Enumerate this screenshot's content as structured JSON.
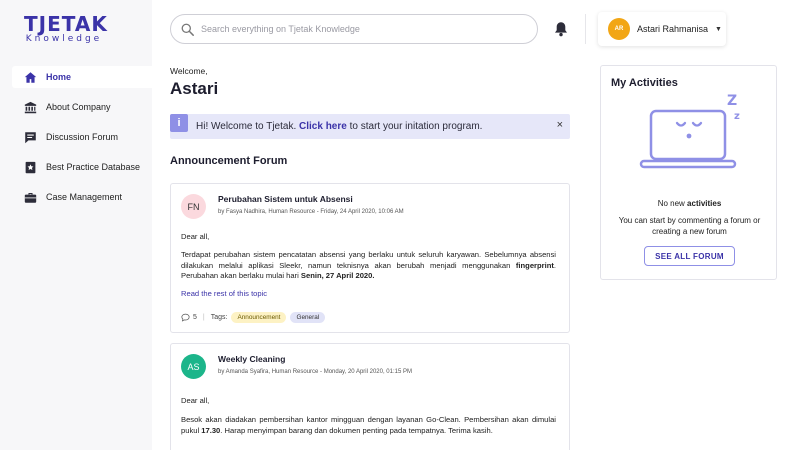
{
  "brand": {
    "logo_main": "TJETAK",
    "logo_sub": "Knowledge",
    "accent": "#3b33a8"
  },
  "sidebar": {
    "items": [
      {
        "label": "Home",
        "icon": "home-icon",
        "active": true
      },
      {
        "label": "About Company",
        "icon": "building-icon",
        "active": false
      },
      {
        "label": "Discussion Forum",
        "icon": "chat-icon",
        "active": false
      },
      {
        "label": "Best Practice Database",
        "icon": "star-book-icon",
        "active": false
      },
      {
        "label": "Case Management",
        "icon": "briefcase-icon",
        "active": false
      }
    ]
  },
  "header": {
    "search_placeholder": "Search everything on Tjetak Knowledge",
    "user": {
      "initials": "AR",
      "name": "Astari Rahmanisa",
      "avatar_color": "#f2a615"
    }
  },
  "main": {
    "welcome": "Welcome,",
    "name": "Astari",
    "banner": {
      "prefix": "Hi! Welcome to Tjetak.",
      "link": "Click here",
      "suffix": "to start your initation program.",
      "info_icon": "i",
      "close_icon": "×"
    },
    "section_title": "Announcement Forum",
    "posts": [
      {
        "initials": "FN",
        "avatar_bg": "#fbd9de",
        "avatar_fg": "#333333",
        "title": "Perubahan Sistem untuk Absensi",
        "meta": "by Fasya Nadhira, Human Resource - Friday, 24 April 2020, 10:06 AM",
        "greeting": "Dear all,",
        "body_before": "Terdapat perubahan sistem pencatatan absensi yang berlaku untuk seluruh karyawan. Sebelumnya absensi dilakukan melalui aplikasi Sleekr, namun teknisnya akan berubah menjadi menggunakan",
        "body_bold_1": "fingerprint",
        "body_middle": ". Perubahan akan berlaku mulai hari",
        "body_bold_2": "Senin, 27 April 2020.",
        "read_more": "Read the rest of this topic",
        "comments": "5",
        "tags_label": "Tags:",
        "tags": [
          "Announcement",
          "General"
        ]
      },
      {
        "initials": "AS",
        "avatar_bg": "#1cb58a",
        "avatar_fg": "#ffffff",
        "title": "Weekly Cleaning",
        "meta": "by Amanda Syafira, Human Resource - Monday, 20 April 2020, 01:15 PM",
        "greeting": "Dear all,",
        "body_before": "Besok akan diadakan pembersihan kantor mingguan dengan layanan Go-Clean. Pembersihan akan dimulai pukul",
        "body_bold_1": "17.30",
        "body_middle": ". Harap menyimpan barang dan dokumen penting pada tempatnya. Terima kasih."
      }
    ]
  },
  "activities": {
    "title": "My Activities",
    "empty_prefix": "No new",
    "empty_bold": "activities",
    "description": "You can start by commenting a forum or creating a new forum",
    "button": "SEE ALL FORUM",
    "sleep_glyphs": "Z z",
    "illustration_color": "#8f90e6"
  }
}
